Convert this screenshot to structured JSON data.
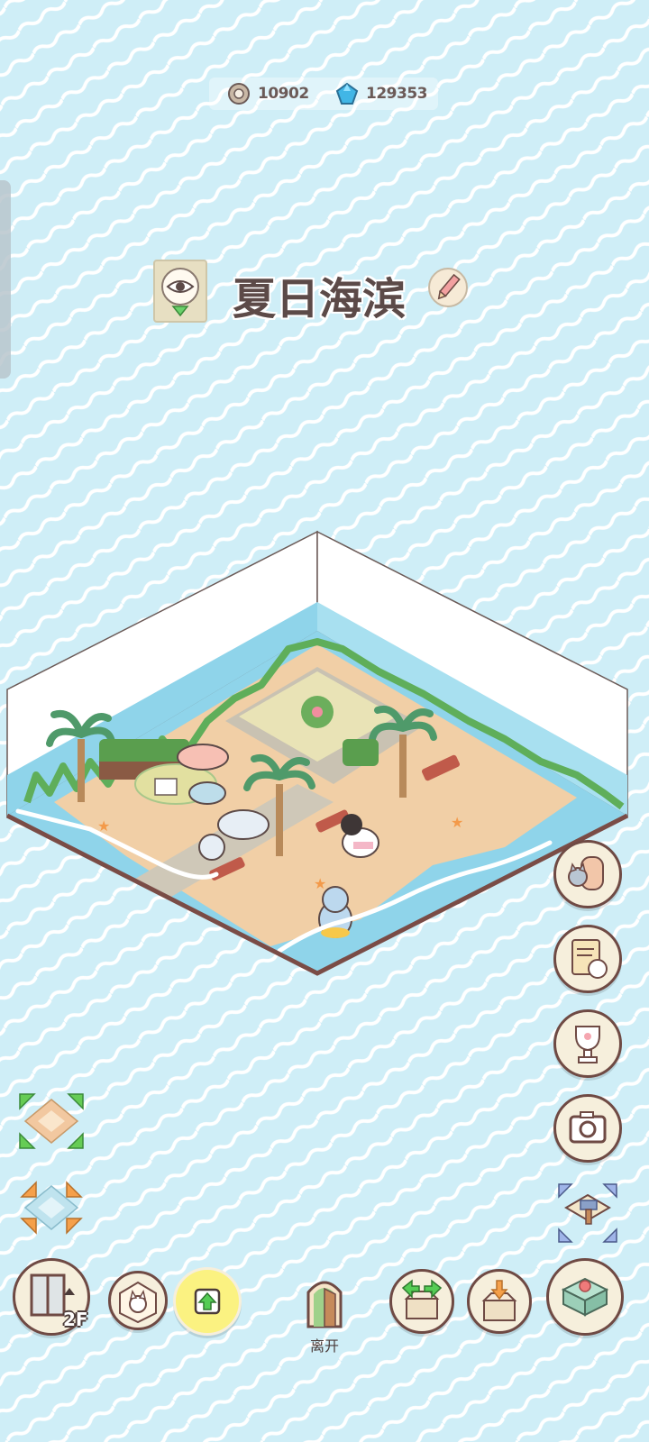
{
  "currency": {
    "coins": "10902",
    "gems": "129353",
    "coin_icon": "cat-coin-icon",
    "gem_icon": "blue-gem-icon"
  },
  "room": {
    "title": "夏日海滨",
    "view_icon": "eye-icon",
    "rename_icon": "pencil-icon"
  },
  "right_menu": [
    {
      "name": "cat-room-button",
      "icon": "cat-door-icon"
    },
    {
      "name": "cat-notes-button",
      "icon": "note-cat-icon"
    },
    {
      "name": "trophy-button",
      "icon": "trophy-paw-icon"
    },
    {
      "name": "camera-button",
      "icon": "camera-icon"
    },
    {
      "name": "build-mode-button",
      "icon": "hammer-icon"
    }
  ],
  "left_tools": [
    {
      "name": "expand-room-button",
      "icon": "expand-arrows-icon"
    },
    {
      "name": "shrink-room-button",
      "icon": "shrink-arrows-icon"
    }
  ],
  "bottom_bar": {
    "floor": "2F",
    "leave_label": "离开",
    "buttons": [
      "elevator-icon",
      "cat-box-icon",
      "upload-arrow-icon",
      "door-icon",
      "box-out-icon",
      "box-in-icon",
      "table-icon"
    ]
  },
  "colors": {
    "background": "#cfeef7",
    "wave": "#ffffff",
    "button_border": "#6f4a44",
    "button_fill": "#f6efdc",
    "highlight_button": "#fbf281"
  }
}
